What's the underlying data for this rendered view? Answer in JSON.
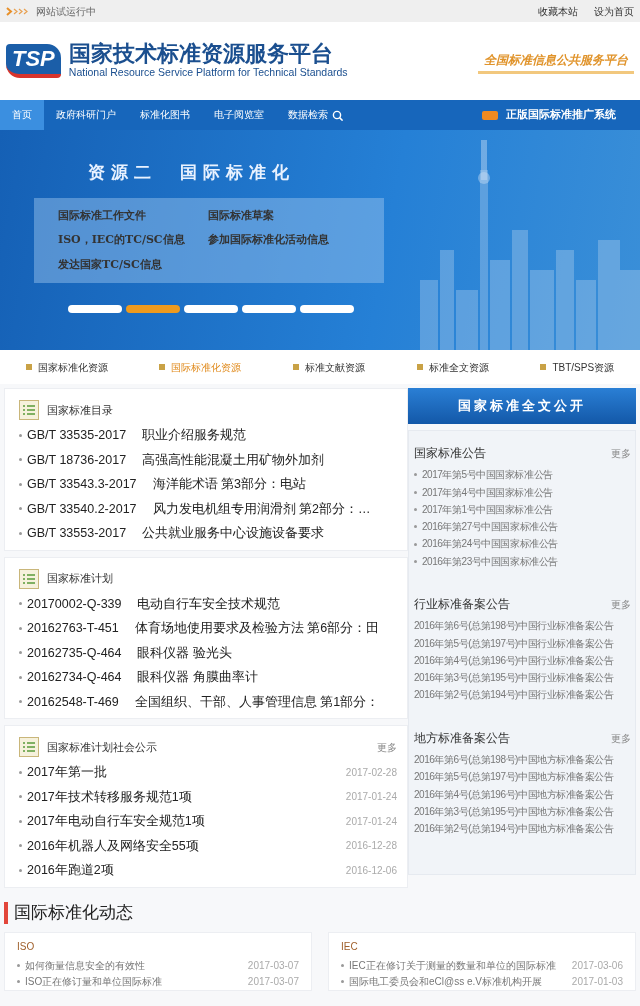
{
  "top_bar": {
    "notice": "网站试运行中",
    "links": [
      "收藏本站",
      "设为首页"
    ]
  },
  "header": {
    "logo_text": "TSP",
    "title_cn": "国家技术标准资源服务平台",
    "title_en": "National Resource Service Platform  for Technical Standards",
    "slogan": "全国标准信息公共服务平台"
  },
  "nav": {
    "items": [
      {
        "label": "首页",
        "selected": true,
        "kind": "link"
      },
      {
        "label": "政府科研门户",
        "selected": false,
        "kind": "link"
      },
      {
        "label": "标准化图书",
        "selected": false,
        "kind": "link"
      },
      {
        "label": "电子阅览室",
        "selected": false,
        "kind": "link"
      },
      {
        "label": "数据检索",
        "selected": false,
        "kind": "search"
      }
    ],
    "promo": "正版国际标准推广系统"
  },
  "banner": {
    "title": "资源二　国际标准化",
    "links": [
      "国际标准工作文件",
      "国际标准草案",
      "ISO，IEC的TC/SC信息",
      "参加国际标准化活动信息",
      "发达国家TC/SC信息"
    ],
    "slides": [
      {
        "selected": false
      },
      {
        "selected": true
      },
      {
        "selected": false
      },
      {
        "selected": false
      },
      {
        "selected": false
      }
    ]
  },
  "resource_tabs": [
    {
      "label": "国家标准化资源",
      "selected": false
    },
    {
      "label": "国际标准化资源",
      "selected": true
    },
    {
      "label": "标准文献资源",
      "selected": false
    },
    {
      "label": "标准全文资源",
      "selected": false
    },
    {
      "label": "TBT/SPS资源",
      "selected": false
    }
  ],
  "left_cards": [
    {
      "title": "国家标准目录",
      "rows": [
        {
          "code": "GB/T 33535-2017",
          "title": "职业介绍服务规范"
        },
        {
          "code": "GB/T 18736-2017",
          "title": "高强高性能混凝土用矿物外加剂"
        },
        {
          "code": "GB/T 33543.3-2017",
          "title": "海洋能术语 第3部分：电站"
        },
        {
          "code": "GB/T 33540.2-2017",
          "title": "风力发电机组专用润滑剂 第2部分：…"
        },
        {
          "code": "GB/T 33553-2017",
          "title": "公共就业服务中心设施设备要求"
        }
      ]
    },
    {
      "title": "国家标准计划",
      "rows": [
        {
          "code": "20170002-Q-339",
          "title": "电动自行车安全技术规范"
        },
        {
          "code": "20162763-T-451",
          "title": "体育场地使用要求及检验方法 第6部分：田"
        },
        {
          "code": "20162735-Q-464",
          "title": "眼科仪器 验光头"
        },
        {
          "code": "20162734-Q-464",
          "title": "眼科仪器 角膜曲率计"
        },
        {
          "code": "20162548-T-469",
          "title": "全国组织、干部、人事管理信息 第1部分："
        }
      ]
    },
    {
      "title": "国家标准计划社会公示",
      "more": "更多",
      "rows": [
        {
          "title": "2017年第一批",
          "date": "2017-02-28"
        },
        {
          "title": "2017年技术转移服务规范1项",
          "date": "2017-01-24"
        },
        {
          "title": "2017年电动自行车安全规范1项",
          "date": "2017-01-24"
        },
        {
          "title": "2016年机器人及网络安全55项",
          "date": "2016-12-28"
        },
        {
          "title": "2016年跑道2项",
          "date": "2016-12-06"
        }
      ]
    }
  ],
  "full_text_button": "国家标准全文公开",
  "announcements": [
    {
      "title": "国家标准公告",
      "more": "更多",
      "kind": "bulleted",
      "items": [
        "2017年第5号中国国家标准公告",
        "2017年第4号中国国家标准公告",
        "2017年第1号中国国家标准公告",
        "2016年第27号中国国家标准公告",
        "2016年第24号中国国家标准公告",
        "2016年第23号中国国家标准公告"
      ]
    },
    {
      "title": "行业标准备案公告",
      "more": "更多",
      "kind": "plain",
      "items": [
        "2016年第6号(总第198号)中国行业标准备案公告",
        "2016年第5号(总第197号)中国行业标准备案公告",
        "2016年第4号(总第196号)中国行业标准备案公告",
        "2016年第3号(总第195号)中国行业标准备案公告",
        "2016年第2号(总第194号)中国行业标准备案公告"
      ]
    },
    {
      "title": "地方标准备案公告",
      "more": "更多",
      "kind": "plain",
      "items": [
        "2016年第6号(总第198号)中国地方标准备案公告",
        "2016年第5号(总第197号)中国地方标准备案公告",
        "2016年第4号(总第196号)中国地方标准备案公告",
        "2016年第3号(总第195号)中国地方标准备案公告",
        "2016年第2号(总第194号)中国地方标准备案公告"
      ]
    }
  ],
  "dynamics": {
    "title": "国际标准化动态",
    "cards": [
      {
        "title": "ISO",
        "rows": [
          {
            "title": "如何衡量信息安全的有效性",
            "date": "2017-03-07"
          },
          {
            "title": "ISO正在修订量和单位国际标准",
            "date": "2017-03-07"
          }
        ]
      },
      {
        "title": "IEC",
        "rows": [
          {
            "title": "IEC正在修订关于测量的数量和单位的国际标准",
            "date": "2017-03-06"
          },
          {
            "title": "国际电工委员会和eCl@ss e.V标准机构开展",
            "date": "2017-01-03"
          }
        ]
      }
    ]
  }
}
